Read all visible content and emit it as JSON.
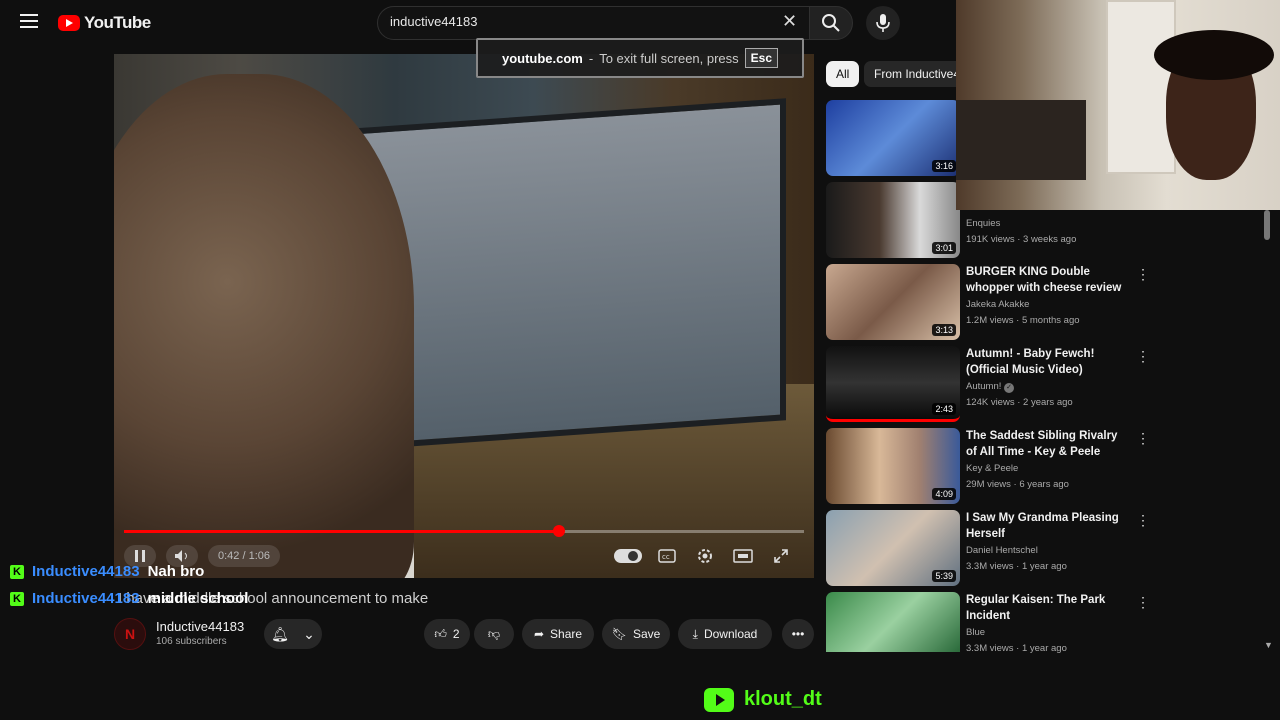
{
  "search": {
    "query": "inductive44183"
  },
  "brand": {
    "logo_text": "YouTube"
  },
  "fullscreen_toast": {
    "site": "youtube.com",
    "separator": "-",
    "message": "To exit full screen, press",
    "key": "Esc"
  },
  "player": {
    "time": "0:42 / 1:06",
    "progress_fraction": 0.64
  },
  "video": {
    "title": "I have a middle school announcement to make",
    "channel": "Inductive44183",
    "subscribers": "106 subscribers",
    "channel_initial": "N",
    "likes": "2",
    "share_label": "Share",
    "save_label": "Save",
    "download_label": "Download"
  },
  "chat": [
    {
      "user": "Inductive44183",
      "message": "Nah bro"
    },
    {
      "user": "Inductive44183",
      "message": "middle school"
    }
  ],
  "streamer": {
    "handle": "klout_dt"
  },
  "chips": [
    {
      "label": "All"
    },
    {
      "label": "From Inductive4"
    }
  ],
  "recommendations": [
    {
      "title": "",
      "channel": "",
      "meta": "",
      "duration": "3:16"
    },
    {
      "title": "",
      "channel": "Enquies",
      "meta": "191K views · 3 weeks ago",
      "duration": "3:01"
    },
    {
      "title": "BURGER KING Double whopper with cheese review",
      "channel": "Jakeka Akakke",
      "meta": "1.2M views · 5 months ago",
      "duration": "3:13"
    },
    {
      "title": "Autumn! - Baby Fewch! (Official Music Video)",
      "channel": "Autumn!",
      "meta": "124K views · 2 years ago",
      "duration": "2:43"
    },
    {
      "title": "The Saddest Sibling Rivalry of All Time - Key & Peele",
      "channel": "Key & Peele",
      "meta": "29M views · 6 years ago",
      "duration": "4:09"
    },
    {
      "title": "I Saw My Grandma Pleasing Herself",
      "channel": "Daniel Hentschel",
      "meta": "3.3M views · 1 year ago",
      "duration": "5:39"
    },
    {
      "title": "Regular Kaisen: The Park Incident",
      "channel": "Blue",
      "meta": "3.3M views · 1 year ago",
      "duration": ""
    }
  ],
  "colors": {
    "accent_red": "#ff0000",
    "kick_green": "#53fc18",
    "chat_user_blue": "#3a8dff"
  }
}
